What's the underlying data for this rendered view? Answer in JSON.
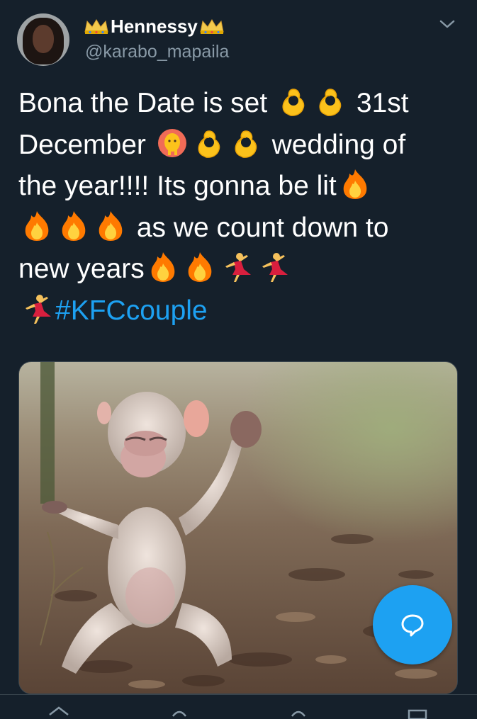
{
  "tweet": {
    "display_name": "Hennessy",
    "handle": "@karabo_mapaila",
    "lines": [
      [
        "Bona the Date is set ",
        ":ok_hand:",
        ":ok_hand:",
        " 31st"
      ],
      [
        "December ",
        ":woman_raising_hand:",
        ":ok_hand:",
        ":ok_hand:",
        " wedding of"
      ],
      [
        "the year!!!! Its gonna be  lit",
        ":fire:"
      ],
      [
        ":fire:",
        ":fire:",
        ":fire:",
        " as we count down to"
      ],
      [
        "new years",
        ":fire:",
        ":fire:",
        ":dancer:",
        ":dancer:"
      ],
      [
        ":dancer:",
        "#KFCcouple"
      ]
    ],
    "hashtag": "#KFCcouple"
  },
  "icons": {
    "crown": "crown-icon",
    "chevron": "chevron-down-icon",
    "compose": "reply-bubble-icon"
  },
  "colors": {
    "background": "#15202b",
    "text": "#ffffff",
    "secondary_text": "#8899a6",
    "accent": "#1da1f2"
  }
}
